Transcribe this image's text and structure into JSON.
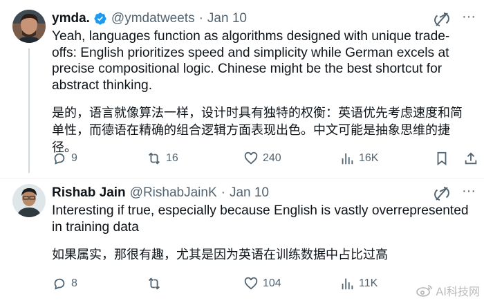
{
  "tweets": [
    {
      "author": {
        "name": "ymda.",
        "handle": "@ymdatweets",
        "verified": true
      },
      "date": "Jan 10",
      "text_en": "Yeah, languages function as algorithms designed with unique trade-offs: English prioritizes speed and simplicity while German excels at precise compositional logic. Chinese might be the best shortcut for abstract thinking.",
      "text_cn": "是的，语言就像算法一样，设计时具有独特的权衡：英语优先考虑速度和简单性，而德语在精确的组合逻辑方面表现出色。中文可能是抽象思维的捷径。",
      "stats": {
        "replies": "9",
        "retweets": "16",
        "likes": "240",
        "views": "16K"
      }
    },
    {
      "author": {
        "name": "Rishab Jain",
        "handle": "@RishabJainK",
        "verified": false
      },
      "date": "Jan 10",
      "text_en": "Interesting if true, especially because English is vastly overrepresented in training data",
      "text_cn": "如果属实，那很有趣，尤其是因为英语在训练数据中占比过高",
      "stats": {
        "replies": "8",
        "retweets": "",
        "likes": "104",
        "views": "11K"
      }
    }
  ],
  "separator": "·",
  "more_label": "···",
  "watermark": "AI科技网",
  "colors": {
    "text": "#0f1419",
    "secondary": "#536471",
    "verified": "#1d9bf0",
    "divider": "#eff3f4"
  },
  "icons": [
    "verified-badge-icon",
    "grok-icon",
    "reply-icon",
    "retweet-icon",
    "like-icon",
    "views-icon",
    "bookmark-icon",
    "share-icon"
  ]
}
